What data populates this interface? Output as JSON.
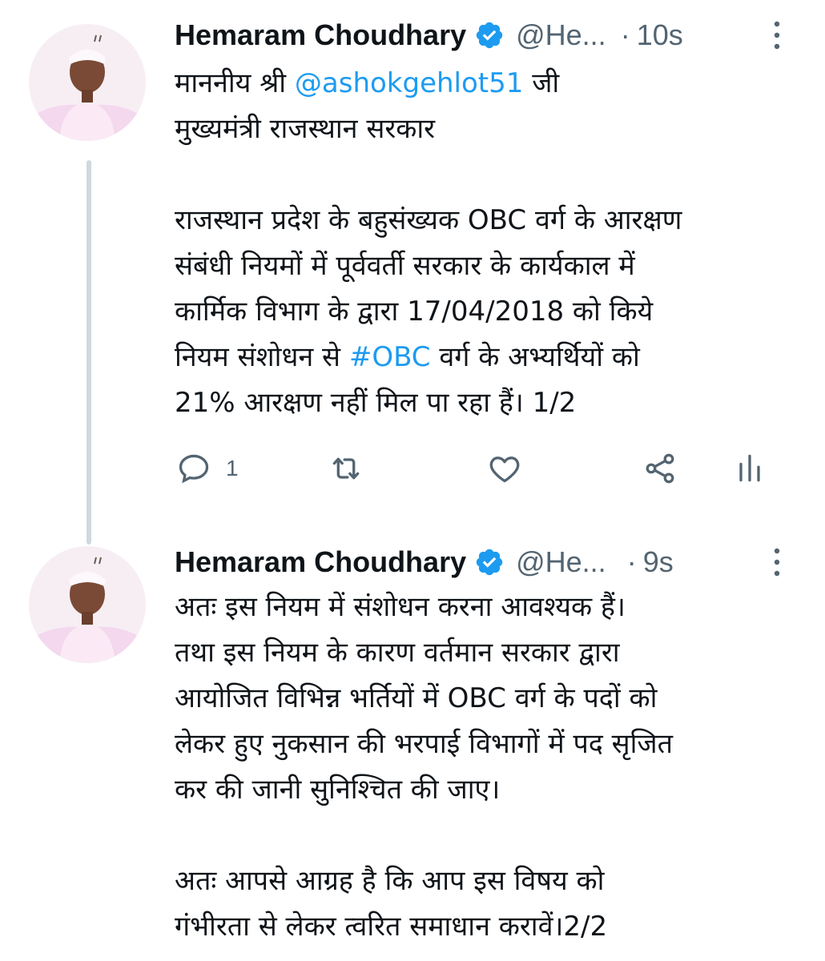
{
  "tweets": [
    {
      "author_name": "Hemaram Choudhary",
      "handle": "@He...",
      "separator": "·",
      "time": "10s",
      "lines": {
        "l1_prefix": "माननीय श्री ",
        "l1_mention": "@ashokgehlot51",
        "l1_suffix": " जी",
        "l2": "मुख्यमंत्री राजस्थान सरकार",
        "l3": "राजस्थान प्रदेश के बहुसंख्यक OBC वर्ग के आरक्षण",
        "l4": "संबंधी नियमों में पूर्ववर्ती सरकार के कार्यकाल में",
        "l5": "कार्मिक विभाग के द्वारा 17/04/2018 को किये",
        "l6_prefix": "नियम संशोधन से ",
        "l6_hashtag": "#OBC",
        "l6_suffix": " वर्ग के अभ्यर्थियों को",
        "l7": "21% आरक्षण नहीं मिल पा रहा हैं। 1/2"
      },
      "reply_count": "1",
      "icons": [
        "comment-icon",
        "retweet-icon",
        "heart-icon",
        "share-icon",
        "analytics-icon"
      ]
    },
    {
      "author_name": "Hemaram Choudhary",
      "handle": "@He...",
      "separator": "·",
      "time": "9s",
      "lines": {
        "l1": "अतः इस नियम में संशोधन करना आवश्यक हैं।",
        "l2": "तथा इस नियम के कारण वर्तमान सरकार द्वारा",
        "l3": "आयोजित विभिन्न भर्तियों में OBC वर्ग के पदों को",
        "l4": "लेकर हुए नुकसान की भरपाई विभागों में पद सृजित",
        "l5": "कर की जानी सुनिश्चित की जाए।",
        "l6": "अतः आपसे आग्रह है कि आप इस विषय को",
        "l7": "गंभीरता से लेकर त्वरित समाधान करावें।2/2"
      }
    }
  ],
  "colors": {
    "text": "#0f1419",
    "secondary": "#536471",
    "link": "#1d9bf0",
    "verified": "#1d9bf0",
    "thread_line": "#cfd9de"
  }
}
